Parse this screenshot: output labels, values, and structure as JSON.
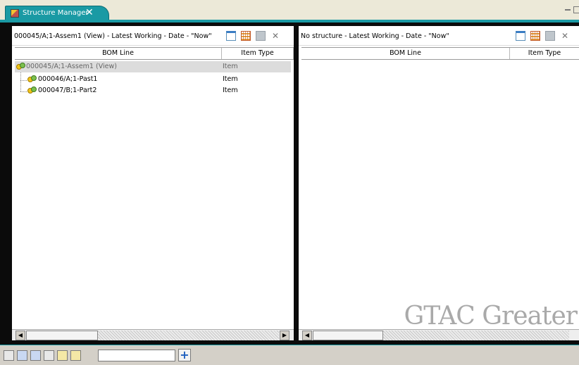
{
  "tab": {
    "label": "Structure Manager",
    "close": "✕"
  },
  "left_pane": {
    "title": "000045/A;1-Assem1 (View) - Latest Working - Date - \"Now\"",
    "columns": [
      "BOM Line",
      "Item Type"
    ],
    "rows": [
      {
        "bom_line": "000045/A;1-Assem1 (View)",
        "item_type": "Item",
        "level": 0,
        "selected": true
      },
      {
        "bom_line": "000046/A;1-Past1",
        "item_type": "Item",
        "level": 1,
        "selected": false
      },
      {
        "bom_line": "000047/B;1-Part2",
        "item_type": "Item",
        "level": 1,
        "selected": false
      }
    ]
  },
  "right_pane": {
    "title": "No structure - Latest Working - Date - \"Now\"",
    "columns": [
      "BOM Line",
      "Item Type"
    ],
    "rows": []
  },
  "toolbar_glyphs": {
    "close": "✕",
    "scroll_left": "◀",
    "scroll_right": "▶",
    "add": "+"
  },
  "bottom_toolbar": {
    "search_value": ""
  },
  "watermark": "GTAC Greater",
  "colors": {
    "accent": "#1a9aa4",
    "frame": "#0b0b0b",
    "selected_row": "#dcdcdc"
  }
}
